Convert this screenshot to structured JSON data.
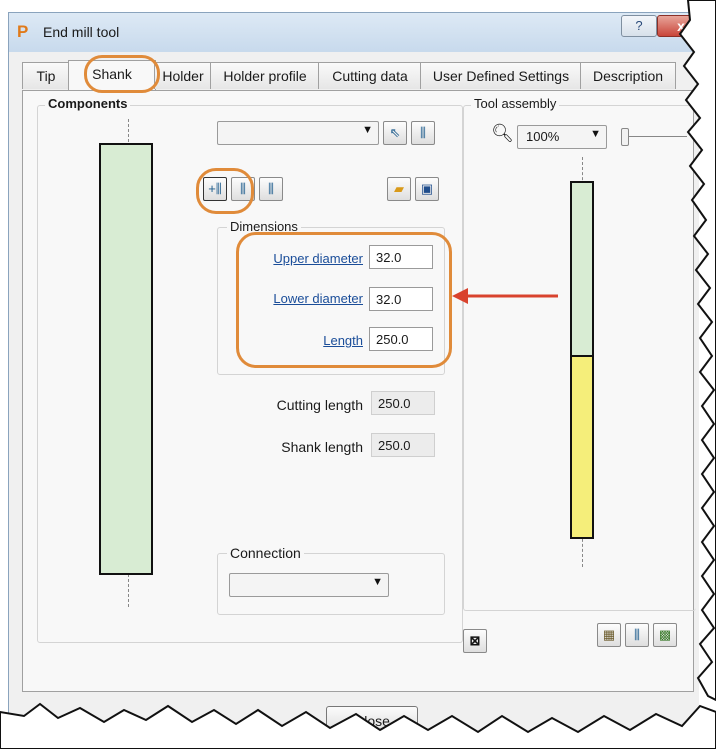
{
  "window": {
    "title": "End mill tool",
    "help_label": "?",
    "close_label": "x"
  },
  "tabs": [
    {
      "label": "Tip"
    },
    {
      "label": "Shank"
    },
    {
      "label": "Holder"
    },
    {
      "label": "Holder profile"
    },
    {
      "label": "Cutting data"
    },
    {
      "label": "User Defined Settings"
    },
    {
      "label": "Description"
    }
  ],
  "components": {
    "group_label": "Components"
  },
  "dimensions": {
    "group_label": "Dimensions",
    "upper_diameter_label": "Upper diameter",
    "upper_diameter_value": "32.0",
    "lower_diameter_label": "Lower diameter",
    "lower_diameter_value": "32.0",
    "length_label": "Length",
    "length_value": "250.0"
  },
  "readonly": {
    "cutting_length_label": "Cutting length",
    "cutting_length_value": "250.0",
    "shank_length_label": "Shank length",
    "shank_length_value": "250.0"
  },
  "connection": {
    "group_label": "Connection",
    "selected": ""
  },
  "tool_assembly": {
    "group_label": "Tool assembly",
    "zoom": "100%"
  },
  "footer": {
    "close_label": "Close"
  },
  "colors": {
    "shank_fill": "#d8ecd3",
    "tip_fill": "#f5ee7a",
    "highlight": "#e08b3a",
    "arrow": "#d9432e"
  },
  "icons": [
    "app-p-icon",
    "select-icon",
    "tool-icon",
    "add-shank-icon",
    "shank-icon",
    "shank-alt-icon",
    "open-folder-icon",
    "save-icon",
    "magnifier-icon",
    "frame-icon",
    "assembly-icon-1",
    "assembly-icon-2",
    "assembly-icon-3"
  ]
}
